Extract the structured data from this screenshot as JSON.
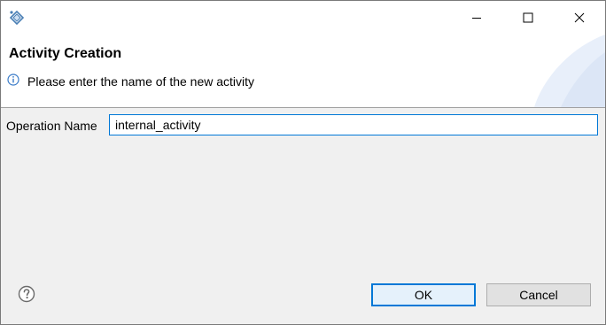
{
  "window": {
    "controls": {
      "minimize": "minimize-icon",
      "maximize": "maximize-icon",
      "close": "close-icon"
    }
  },
  "header": {
    "title": "Activity Creation",
    "message": "Please enter the name of the new activity",
    "message_icon": "info-icon"
  },
  "form": {
    "operation_name_label": "Operation Name",
    "operation_name_value": "internal_activity"
  },
  "footer": {
    "help_icon": "help-icon",
    "ok_label": "OK",
    "cancel_label": "Cancel"
  },
  "colors": {
    "accent": "#0078d7",
    "dialog_bg": "#f0f0f0"
  }
}
